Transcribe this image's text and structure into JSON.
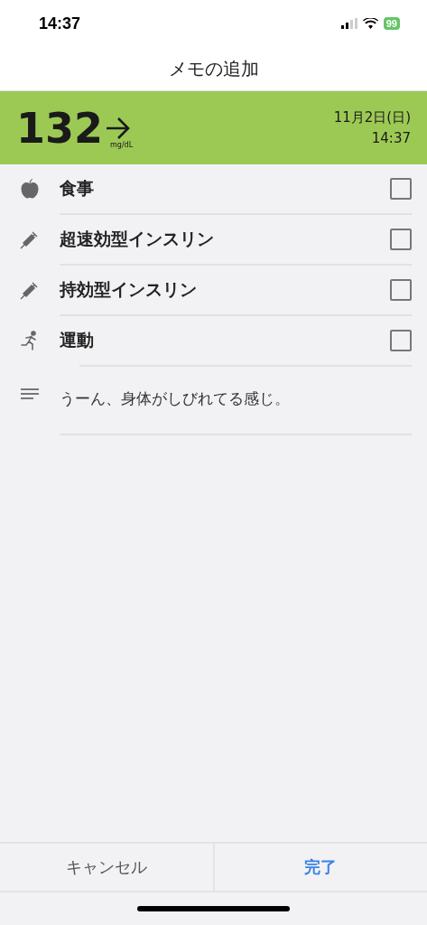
{
  "status_bar": {
    "time": "14:37",
    "battery": "99"
  },
  "title": "メモの追加",
  "reading": {
    "value": "132",
    "unit": "mg/dL",
    "date": "11月2日(日)",
    "time": "14:37"
  },
  "items": [
    {
      "kind": "meal",
      "label": "食事",
      "checked": false
    },
    {
      "kind": "insulin",
      "label": "超速効型インスリン",
      "checked": false
    },
    {
      "kind": "insulin",
      "label": "持効型インスリン",
      "checked": false
    },
    {
      "kind": "exercise",
      "label": "運動",
      "checked": false
    }
  ],
  "note": {
    "value": "うーん、身体がしびれてる感じ。"
  },
  "buttons": [
    {
      "kind": "cancel",
      "label": "キャンセル"
    },
    {
      "kind": "done",
      "label": "完了"
    }
  ]
}
